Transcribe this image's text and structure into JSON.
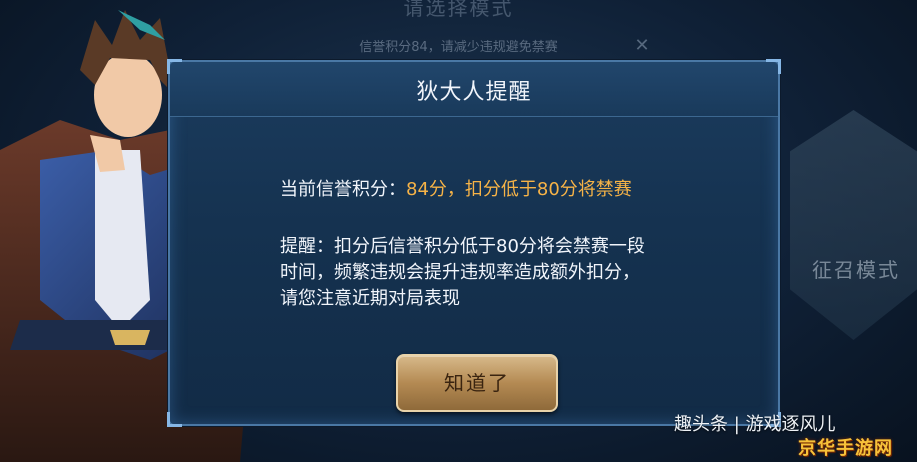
{
  "background": {
    "top_title": "请选择模式",
    "top_warning": "信誉积分84，请减少违规避免禁赛",
    "mode_card_label": "征召模式"
  },
  "dialog": {
    "title": "狄大人提醒",
    "score_prefix": "当前信誉积分：",
    "score_highlight": "84分，扣分低于80分将禁赛",
    "notice_lines": [
      "提醒：扣分后信誉积分低于80分将会禁赛一段",
      "时间，频繁违规会提升违规率造成额外扣分，",
      "请您注意近期对局表现"
    ],
    "ok_label": "知道了"
  },
  "overlay": {
    "watermark": "趣头条 | 游戏逐风儿",
    "brand": "京华手游网"
  },
  "colors": {
    "highlight": "#f6b347",
    "dialog_bg": "#153250",
    "dialog_border": "#4a78a5",
    "button_gold": "#b48a53"
  }
}
